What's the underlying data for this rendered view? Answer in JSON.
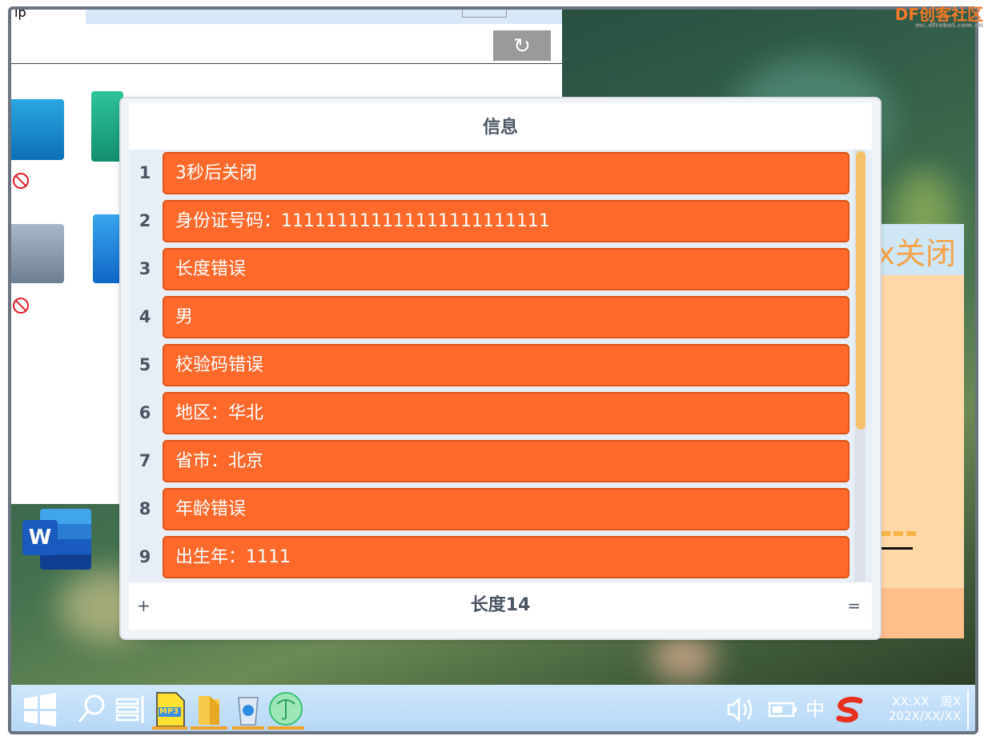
{
  "watermark": {
    "brand": "DF创客社区",
    "url": "mc.dfrobot.com.cn"
  },
  "background_window": {
    "title_partial": "ip",
    "refresh_symbol": "↻"
  },
  "right_panel": {
    "title_partial": "x关闭"
  },
  "dialog": {
    "title": "信息",
    "rows": [
      {
        "num": "1",
        "text": "3秒后关闭"
      },
      {
        "num": "2",
        "text": "身份证号码：111111111111111111111111"
      },
      {
        "num": "3",
        "text": "长度错误"
      },
      {
        "num": "4",
        "text": "男"
      },
      {
        "num": "5",
        "text": "校验码错误"
      },
      {
        "num": "6",
        "text": "地区：华北"
      },
      {
        "num": "7",
        "text": "省市：北京"
      },
      {
        "num": "8",
        "text": "年龄错误"
      },
      {
        "num": "9",
        "text": "出生年：1111"
      }
    ],
    "footer": {
      "add": "+",
      "length_label": "长度14",
      "equals": "="
    },
    "scroll_fraction": 0.64
  },
  "desktop": {
    "word_badge": "W"
  },
  "taskbar": {
    "mp3_label": "MP3",
    "ime": "中",
    "clock": {
      "time": "XX:XX",
      "weekday": "周X",
      "date": "202X/XX/XX"
    }
  },
  "colors": {
    "row_fill": "#ff6a2c",
    "accent_orange": "#f3a227",
    "scroll_thumb": "#f5c26b",
    "panel_peach": "#ffd8a8"
  }
}
